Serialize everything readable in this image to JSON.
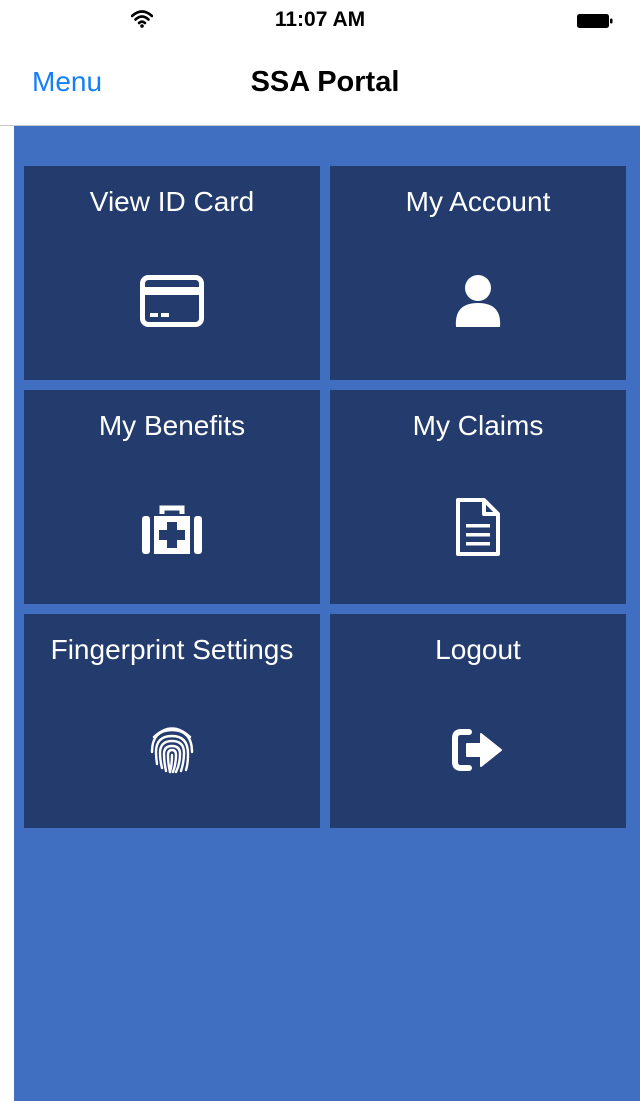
{
  "status_bar": {
    "time": "11:07 AM",
    "wifi_icon": "wifi-icon",
    "battery_icon": "battery-icon"
  },
  "nav": {
    "menu_label": "Menu",
    "title": "SSA Portal"
  },
  "colors": {
    "accent": "#147efb",
    "background": "#406ec0",
    "tile": "#233c6d",
    "tile_text": "#ffffff"
  },
  "tiles": [
    {
      "label": "View ID Card",
      "icon": "id-card-icon"
    },
    {
      "label": "My Account",
      "icon": "user-icon"
    },
    {
      "label": "My Benefits",
      "icon": "medical-kit-icon"
    },
    {
      "label": "My Claims",
      "icon": "document-icon"
    },
    {
      "label": "Fingerprint Settings",
      "icon": "fingerprint-icon"
    },
    {
      "label": "Logout",
      "icon": "logout-icon"
    }
  ]
}
